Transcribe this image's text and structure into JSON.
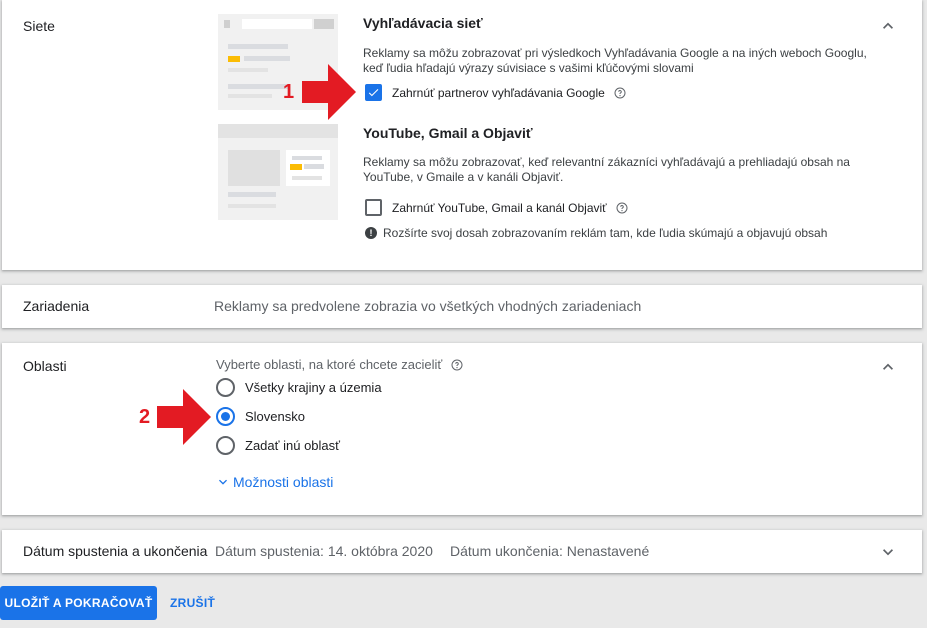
{
  "networks": {
    "section_label": "Siete",
    "search": {
      "title": "Vyhľadávacia sieť",
      "description": "Reklamy sa môžu zobrazovať pri výsledkoch Vyhľadávania Google a na iných weboch Googlu, keď ľudia hľadajú výrazy súvisiace s vašimi kľúčovými slovami",
      "checkbox_label": "Zahrnúť partnerov vyhľadávania Google",
      "checked": true
    },
    "youtube": {
      "title": "YouTube, Gmail a Objaviť",
      "description": "Reklamy sa môžu zobrazovať, keď relevantní zákazníci vyhľadávajú a prehliadajú obsah na YouTube, v Gmaile a v kanáli Objaviť.",
      "checkbox_label": "Zahrnúť YouTube, Gmail a kanál Objaviť",
      "checked": false,
      "info": "Rozšírte svoj dosah zobrazovaním reklám tam, kde ľudia skúmajú a objavujú obsah"
    }
  },
  "devices": {
    "section_label": "Zariadenia",
    "summary": "Reklamy sa predvolene zobrazia vo všetkých vhodných zariadeniach"
  },
  "locations": {
    "section_label": "Oblasti",
    "prompt": "Vyberte oblasti, na ktoré chcete zacieliť",
    "options": [
      {
        "label": "Všetky krajiny a územia",
        "selected": false
      },
      {
        "label": "Slovensko",
        "selected": true
      },
      {
        "label": "Zadať inú oblasť",
        "selected": false
      }
    ],
    "more_link": "Možnosti oblasti"
  },
  "dates": {
    "section_label": "Dátum spustenia a ukončenia",
    "start": "Dátum spustenia: 14. októbra 2020",
    "end": "Dátum ukončenia: Nenastavené"
  },
  "annotations": {
    "one": "1",
    "two": "2",
    "color": "#e31b23"
  },
  "actions": {
    "save": "ULOŽIŤ A POKRAČOVAŤ",
    "cancel": "ZRUŠIŤ"
  },
  "colors": {
    "accent": "#1a73e8"
  }
}
